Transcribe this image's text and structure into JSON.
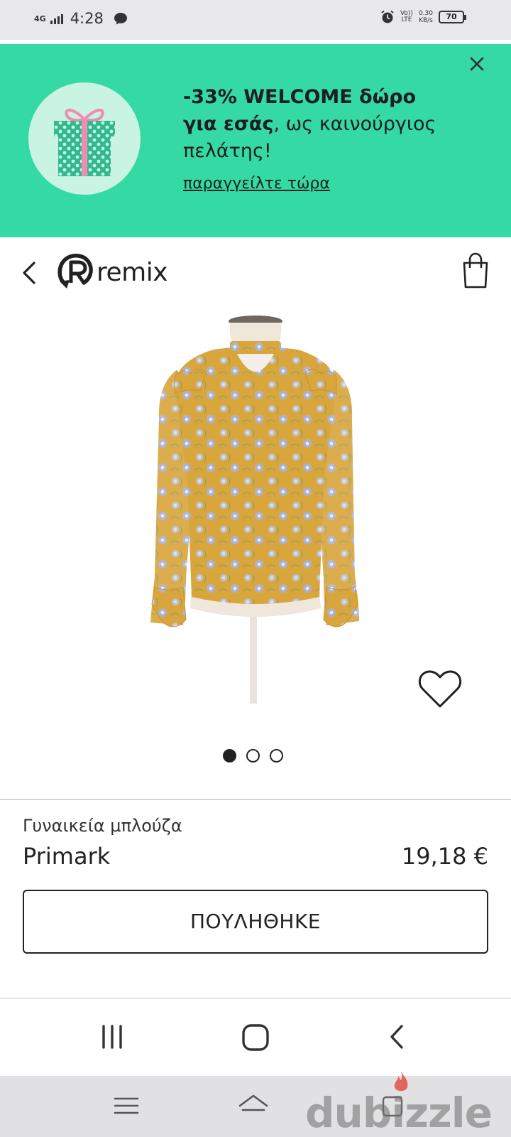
{
  "status_bar": {
    "network": "4G",
    "time": "4:28",
    "volte_top": "Vo))",
    "volte_bottom": "LTE",
    "speed_value": "0.30",
    "speed_unit": "KB/s",
    "battery": "70"
  },
  "promo": {
    "headline_bold": "-33% WELCOME δώρο για εσάς",
    "headline_rest": ", ως καινούργιος πελάτης!",
    "link": "παραγγείλτε τώρα",
    "background_color": "#34d9a3"
  },
  "header": {
    "logo_text": "remix"
  },
  "gallery": {
    "image_count": 3,
    "active_index": 0
  },
  "product": {
    "category": "Γυναικεία μπλούζα",
    "brand": "Primark",
    "price": "19,18 €",
    "status_button": "ΠΟΥΛΗΘΗΚΕ"
  },
  "watermark": {
    "text": "dubizzle"
  },
  "icons": [
    "close-icon",
    "gift-icon",
    "back-arrow-icon",
    "remix-logo-icon",
    "shopping-bag-icon",
    "heart-icon",
    "recent-apps-icon",
    "home-icon",
    "back-icon",
    "menu-icon",
    "chevron-up-icon",
    "tabs-icon"
  ]
}
